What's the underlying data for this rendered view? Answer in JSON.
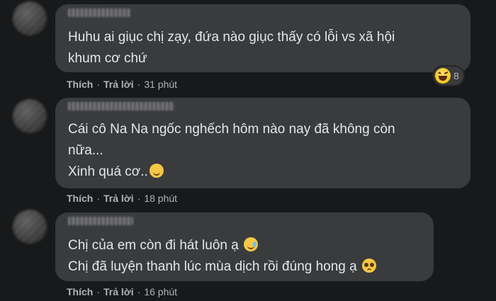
{
  "comments": [
    {
      "text": "Huhu ai giục chị zạy, đứa nào giục thấy có lỗi vs xã hội\nkhum cơ chứ",
      "like_label": "Thích",
      "reply_label": "Trả lời",
      "time": "31 phút",
      "reaction": {
        "icon": "haha-icon",
        "count": "8"
      }
    },
    {
      "text": "Cái cô Na Na ngốc nghếch hôm nào nay đã không còn\nnữa...\nXinh quá cơ..",
      "emoji": "smiling-blush-emoji",
      "like_label": "Thích",
      "reply_label": "Trả lời",
      "time": "18 phút"
    },
    {
      "line1": "Chị của em còn đi hát luôn ạ",
      "line1_emoji": "smiling-tear-emoji",
      "line2": "Chị đã luyện thanh lúc mùa dịch rồi đúng hong ạ",
      "line2_emoji": "pleading-face-emoji",
      "like_label": "Thích",
      "reply_label": "Trả lời",
      "time": "16 phút"
    }
  ],
  "separator": "·"
}
